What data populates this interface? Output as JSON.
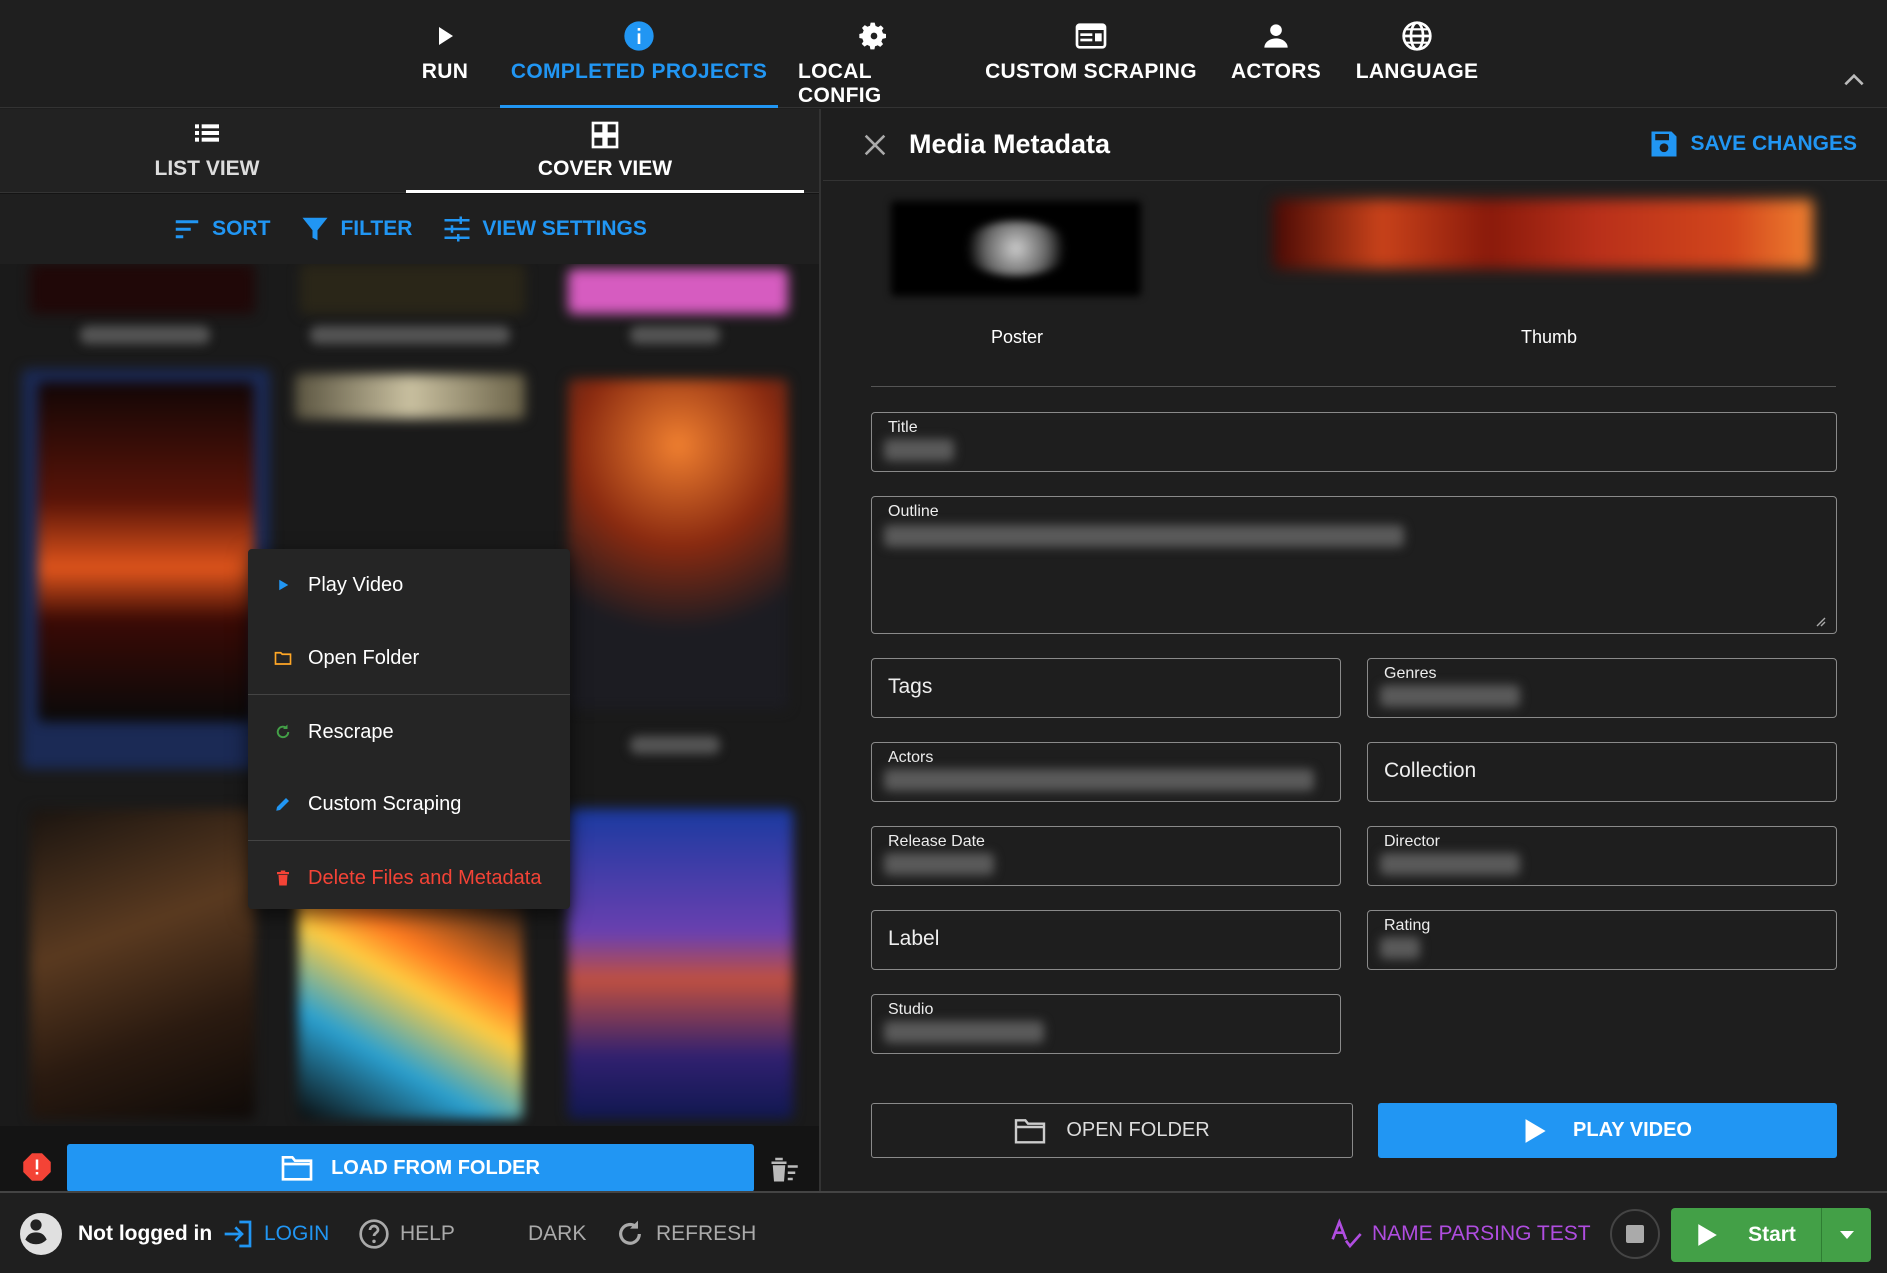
{
  "nav": {
    "tabs": [
      {
        "label": "RUN",
        "icon": "play-icon"
      },
      {
        "label": "COMPLETED PROJECTS",
        "icon": "info-icon",
        "active": true
      },
      {
        "label": "LOCAL CONFIG",
        "icon": "gear-icon"
      },
      {
        "label": "CUSTOM SCRAPING",
        "icon": "browser-window-icon"
      },
      {
        "label": "ACTORS",
        "icon": "person-icon"
      },
      {
        "label": "LANGUAGE",
        "icon": "globe-icon"
      }
    ],
    "accent": "#2196f3"
  },
  "left": {
    "view_tabs": [
      {
        "label": "LIST VIEW",
        "icon": "list-icon"
      },
      {
        "label": "COVER VIEW",
        "icon": "grid-icon",
        "active": true
      }
    ],
    "toolbar": {
      "sort": "SORT",
      "filter": "FILTER",
      "view_settings": "VIEW SETTINGS"
    },
    "context_menu": {
      "play_video": "Play Video",
      "open_folder": "Open Folder",
      "rescrape": "Rescrape",
      "custom_scraping": "Custom Scraping",
      "delete": "Delete Files and Metadata"
    },
    "load_from_folder": "LOAD FROM FOLDER"
  },
  "right": {
    "title": "Media Metadata",
    "save_changes": "SAVE CHANGES",
    "poster_label": "Poster",
    "thumb_label": "Thumb",
    "fields": {
      "title": "Title",
      "outline": "Outline",
      "tags": "Tags",
      "genres": "Genres",
      "actors": "Actors",
      "collection": "Collection",
      "release_date": "Release Date",
      "director": "Director",
      "label": "Label",
      "rating": "Rating",
      "studio": "Studio"
    },
    "open_folder": "OPEN FOLDER",
    "play_video": "PLAY VIDEO"
  },
  "footer": {
    "not_logged_in": "Not logged in",
    "login": "LOGIN",
    "help": "HELP",
    "dark": "DARK",
    "refresh": "REFRESH",
    "name_parsing_test": "NAME PARSING TEST",
    "start": "Start",
    "colors": {
      "login": "#2196f3",
      "name_parsing": "#b04de0",
      "start": "#43a047",
      "danger": "#f44336"
    }
  }
}
